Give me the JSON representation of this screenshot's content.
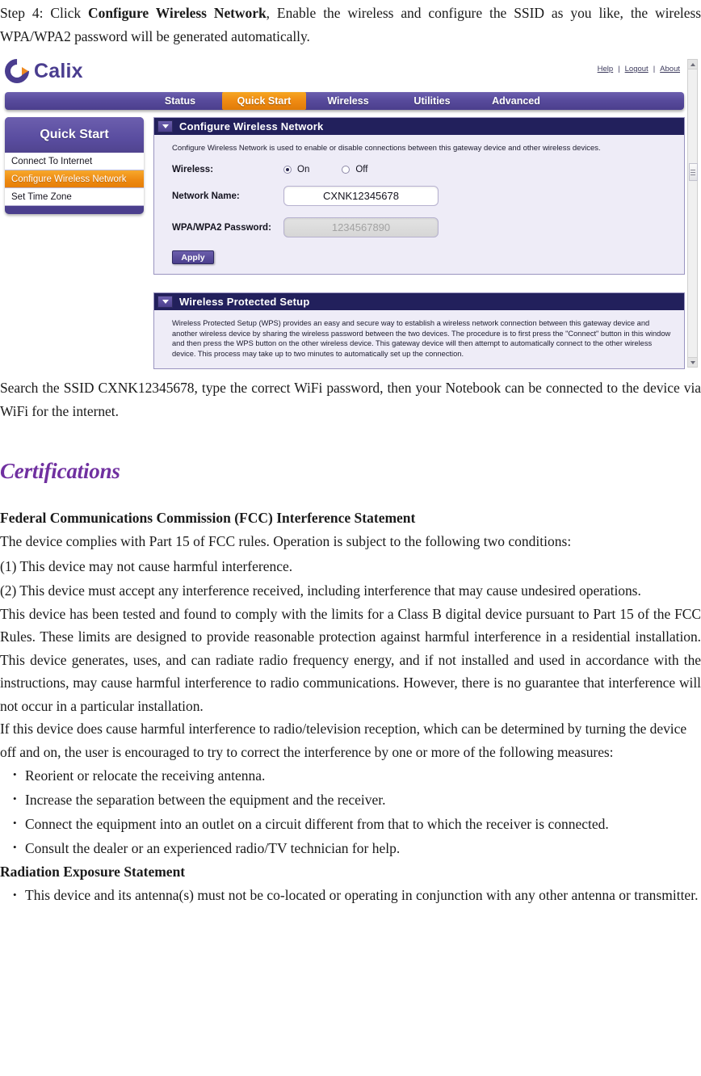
{
  "intro": {
    "step_prefix": "Step 4: Click ",
    "step_bold": "Configure Wireless Network",
    "step_suffix": ", Enable the wireless and configure the SSID as you like, the wireless WPA/WPA2 password will be generated automatically."
  },
  "screenshot": {
    "brand": "Calix",
    "top_links": [
      "Help",
      "Logout",
      "About"
    ],
    "separator": "|",
    "nav_tabs": [
      {
        "label": "Status",
        "active": false
      },
      {
        "label": "Quick Start",
        "active": true
      },
      {
        "label": "Wireless",
        "active": false
      },
      {
        "label": "Utilities",
        "active": false
      },
      {
        "label": "Advanced",
        "active": false
      }
    ],
    "sidebar": {
      "title": "Quick Start",
      "items": [
        {
          "label": "Connect To Internet",
          "selected": false
        },
        {
          "label": "Configure Wireless Network",
          "selected": true
        },
        {
          "label": "Set Time Zone",
          "selected": false
        }
      ]
    },
    "wireless_panel": {
      "title": "Configure Wireless Network",
      "description": "Configure Wireless Network is used to enable or disable connections between this gateway device and other wireless devices.",
      "wireless_label": "Wireless:",
      "radio_on": "On",
      "radio_off": "Off",
      "selected_radio": "On",
      "network_name_label": "Network Name:",
      "network_name_value": "CXNK12345678",
      "password_label": "WPA/WPA2 Password:",
      "password_value": "1234567890",
      "apply_label": "Apply"
    },
    "wps_panel": {
      "title": "Wireless Protected Setup",
      "description": "Wireless Protected Setup (WPS) provides an easy and secure way to establish a wireless network connection between this gateway device and another wireless device by sharing the wireless password between the two devices.  The procedure is to first press the \"Connect\" button in this window and then press the WPS button on the other wireless device.  This gateway device will then attempt to automatically connect to the other wireless device.  This process may take up to two minutes to automatically set up the connection."
    },
    "colors": {
      "purple": "#4b3f8d",
      "orange": "#ef8a12",
      "header_navy": "#22205c",
      "panel_background": "#eeecf7"
    }
  },
  "after_shot_paragraph": "Search the SSID CXNK12345678, type the correct WiFi password, then your Notebook can be connected to the device via WiFi for the internet.",
  "certifications": {
    "heading": "Certifications",
    "heading_color": "#7030a0",
    "fcc_heading": "Federal Communications Commission (FCC) Interference Statement",
    "lines": [
      "The device complies with Part 15 of FCC rules. Operation is subject to the following two conditions:",
      "(1) This device may not cause harmful interference."
    ],
    "condition2": "(2) This device must accept any interference received, including interference that may cause undesired operations.",
    "long_paragraph_1": "This device has been tested and found to comply with the limits for a Class B digital device pursuant to Part 15 of the FCC Rules. These limits are designed to provide reasonable protection against harmful interference in a residential installation. This device generates, uses, and can radiate radio frequency energy, and if not installed and used in accordance with the instructions, may cause harmful interference to radio communications. However, there is no guarantee that interference will not occur in a particular installation.",
    "long_paragraph_2": "If this device does cause harmful interference to radio/television reception, which can be determined by turning the device off and on, the user is encouraged to try to correct the interference by one or more of the following measures:",
    "measures": [
      "Reorient or relocate the receiving antenna.",
      "Increase the separation between the equipment and the receiver.",
      "Connect the equipment into an outlet on a circuit different from that to which the receiver is connected.",
      "Consult the dealer or an experienced radio/TV technician for help."
    ],
    "radiation_heading": "Radiation Exposure Statement",
    "radiation_bullets": [
      "This device and its antenna(s) must not be co-located or operating in conjunction with any other antenna or transmitter."
    ]
  }
}
